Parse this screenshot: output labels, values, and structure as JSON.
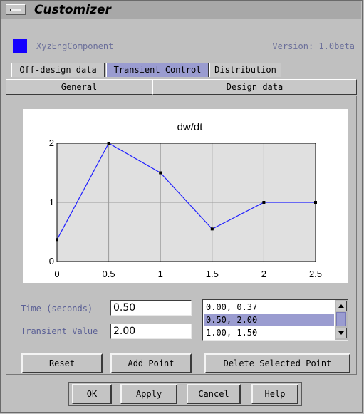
{
  "window": {
    "title": "Customizer"
  },
  "component": {
    "name": "XyzEngComponent",
    "version": "Version: 1.0beta",
    "color": "#1500ff"
  },
  "tabs_row1": [
    {
      "label": "Off-design data",
      "active": false
    },
    {
      "label": "Transient Control",
      "active": true
    },
    {
      "label": "Distribution",
      "active": false
    }
  ],
  "tabs_row2": [
    {
      "label": "General"
    },
    {
      "label": "Design data"
    }
  ],
  "chart_data": {
    "type": "line",
    "title": "dw/dt",
    "xlabel": "",
    "ylabel": "",
    "x": [
      0,
      0.5,
      1,
      1.5,
      2,
      2.5
    ],
    "y": [
      0.37,
      2.0,
      1.5,
      0.55,
      1.0,
      1.0
    ],
    "xlim": [
      0,
      2.5
    ],
    "ylim": [
      0,
      2
    ],
    "x_ticks": [
      "0",
      "0.5",
      "1",
      "1.5",
      "2",
      "2.5"
    ],
    "y_ticks": [
      "0",
      "1",
      "2"
    ],
    "grid": true,
    "line_color": "#2020ff",
    "plot_bg": "#e0e0e0"
  },
  "form": {
    "time_label": "Time (seconds)",
    "time_value": "0.50",
    "transient_label": "Transient Value",
    "transient_value": "2.00"
  },
  "points_list": {
    "items": [
      "0.00, 0.37",
      "0.50, 2.00",
      "1.00, 1.50"
    ],
    "selected_index": 1
  },
  "actions": {
    "reset": "Reset",
    "add_point": "Add Point",
    "delete_point": "Delete Selected Point"
  },
  "footer": {
    "ok": "OK",
    "apply": "Apply",
    "cancel": "Cancel",
    "help": "Help"
  }
}
